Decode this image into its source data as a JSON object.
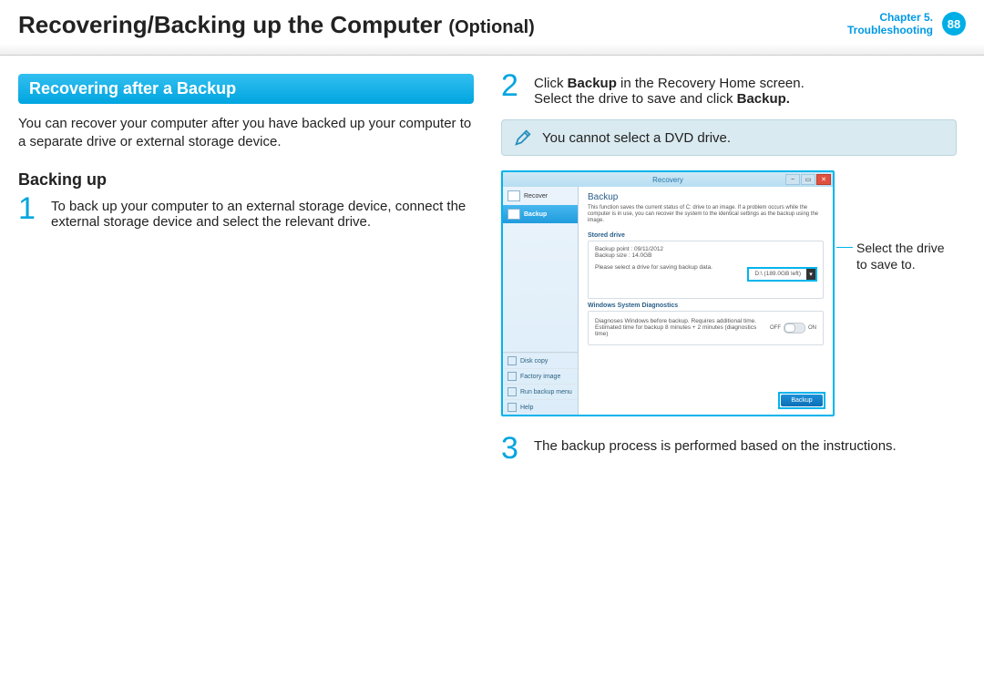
{
  "header": {
    "title_main": "Recovering/Backing up the Computer",
    "title_suffix": "(Optional)",
    "chapter_line1": "Chapter 5.",
    "chapter_line2": "Troubleshooting",
    "page_number": "88"
  },
  "left": {
    "section_title": "Recovering after a Backup",
    "intro": "You can recover your computer after you have backed up your computer to a separate drive or external storage device.",
    "subhead": "Backing up",
    "step1_num": "1",
    "step1_text": "To back up your computer to an external storage device, connect the external storage device and select the relevant drive."
  },
  "right": {
    "step2_num": "2",
    "step2_a": "Click ",
    "step2_b": "Backup",
    "step2_c": " in the Recovery Home screen.",
    "step2_line2a": "Select the drive to save and click ",
    "step2_line2b": "Backup.",
    "note": "You cannot select a DVD drive.",
    "callout": "Select the drive to save to.",
    "step3_num": "3",
    "step3_text": "The backup process is performed based on the instructions."
  },
  "app": {
    "title": "Recovery",
    "side": {
      "recover": "Recover",
      "backup": "Backup",
      "disk_copy": "Disk copy",
      "factory_image": "Factory image",
      "run_backup": "Run backup menu",
      "help": "Help"
    },
    "main": {
      "title": "Backup",
      "desc": "This function saves the current status of C: drive to an image.\nIf a problem occurs while the computer is in use, you can recover the system to the identical settings as the backup using the image.",
      "stored_label": "Stored drive",
      "backup_point": "Backup point : 09/11/2012",
      "backup_size": "Backup size : 14.0GB",
      "select_prompt": "Please select a drive for saving backup data.",
      "drive_value": "D:\\ (189.0GB left)",
      "diag_label": "Windows System Diagnostics",
      "diag_text": "Diagnoses Windows before backup. Requires additional time.\nEstimated time for backup 8 minutes + 2 minutes (diagnostics time)",
      "toggle_off": "OFF",
      "toggle_on": "ON",
      "backup_btn": "Backup"
    }
  }
}
